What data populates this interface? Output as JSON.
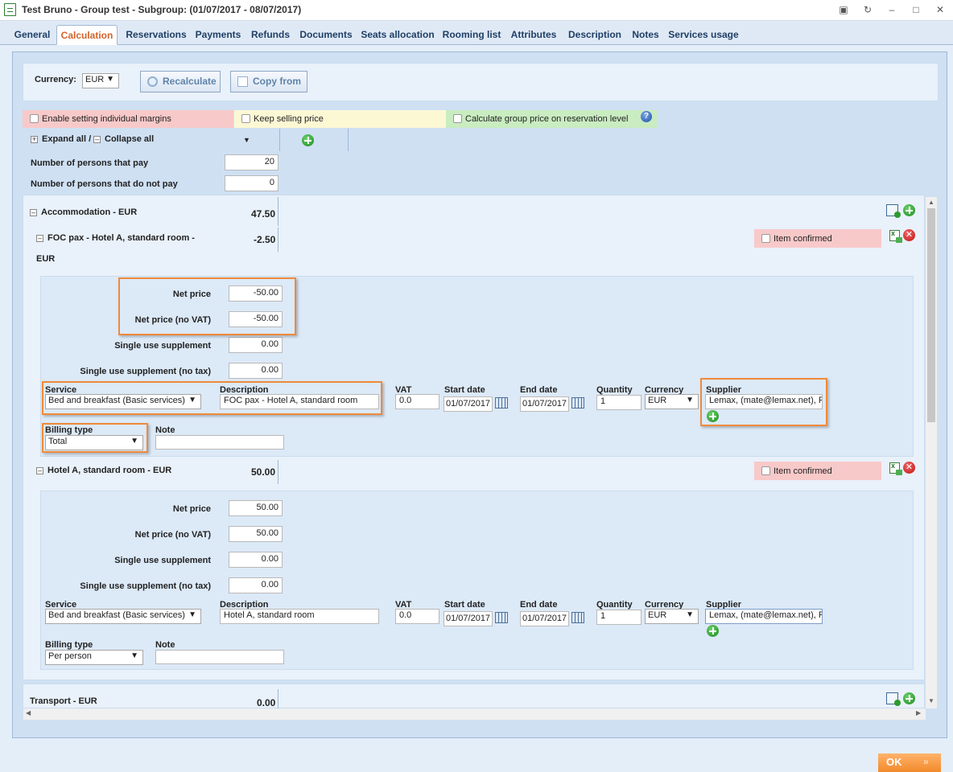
{
  "window": {
    "title": "Test Bruno - Group test - Subgroup: (01/07/2017 - 08/07/2017)"
  },
  "tabs": [
    "General",
    "Calculation",
    "Reservations",
    "Payments",
    "Refunds",
    "Documents",
    "Seats allocation",
    "Rooming list",
    "Attributes",
    "Description",
    "Notes",
    "Services usage"
  ],
  "active_tab": "Calculation",
  "toolbar": {
    "currency_label": "Currency:",
    "currency_value": "EUR",
    "recalculate_label": "Recalculate",
    "copy_from_label": "Copy from"
  },
  "options": {
    "individual_margins_label": "Enable setting individual margins",
    "keep_selling_price_label": "Keep selling price",
    "group_price_label": "Calculate group price on reservation level",
    "expand_all_label": "Expand all /",
    "collapse_all_label": "Collapse all"
  },
  "persons": {
    "pay_label": "Number of persons that pay",
    "pay_value": "20",
    "nopay_label": "Number of persons that do not pay",
    "nopay_value": "0"
  },
  "labels": {
    "net_price": "Net price",
    "net_price_no_vat": "Net price (no VAT)",
    "single_use": "Single use supplement",
    "single_use_no_tax": "Single use supplement (no tax)",
    "service": "Service",
    "description": "Description",
    "vat": "VAT",
    "start_date": "Start date",
    "end_date": "End date",
    "quantity": "Quantity",
    "currency": "Currency",
    "supplier": "Supplier",
    "billing_type": "Billing type",
    "note": "Note",
    "item_confirmed": "Item confirmed"
  },
  "accommodation": {
    "title": "Accommodation - EUR",
    "total": "47.50"
  },
  "items": [
    {
      "title": "FOC pax - Hotel A, standard room -",
      "title_cont": "EUR",
      "total": "-2.50",
      "net_price": "-50.00",
      "net_price_no_vat": "-50.00",
      "single_use": "0.00",
      "single_use_no_tax": "0.00",
      "service": "Bed and breakfast (Basic services)",
      "description": "FOC pax - Hotel A, standard room",
      "vat": "0.0",
      "start_date": "01/07/2017",
      "end_date": "01/07/2017",
      "quantity": "1",
      "currency": "EUR",
      "supplier": "Lemax, (mate@lemax.net), R",
      "billing_type": "Total",
      "note": ""
    },
    {
      "title": "Hotel A, standard room - EUR",
      "total": "50.00",
      "net_price": "50.00",
      "net_price_no_vat": "50.00",
      "single_use": "0.00",
      "single_use_no_tax": "0.00",
      "service": "Bed and breakfast (Basic services)",
      "description": "Hotel A, standard room",
      "vat": "0.0",
      "start_date": "01/07/2017",
      "end_date": "01/07/2017",
      "quantity": "1",
      "currency": "EUR",
      "supplier": "Lemax, (mate@lemax.net), R",
      "billing_type": "Per person",
      "note": ""
    }
  ],
  "transport": {
    "title": "Transport - EUR",
    "total": "0.00"
  },
  "ok_label": "OK"
}
